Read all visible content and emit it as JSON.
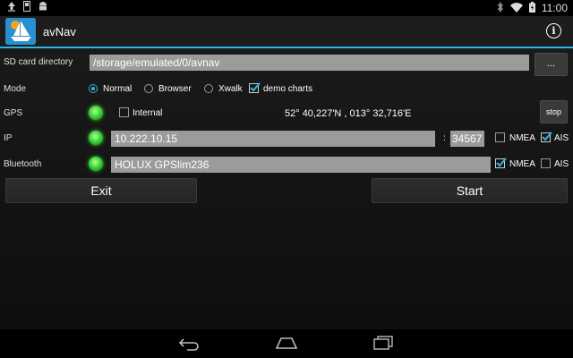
{
  "status_bar": {
    "time": "11:00"
  },
  "app": {
    "title": "avNav"
  },
  "sdcard": {
    "label": "SD card directory",
    "path": "/storage/emulated/0/avnav",
    "browse_label": "..."
  },
  "mode": {
    "label": "Mode",
    "options": [
      {
        "label": "Normal",
        "selected": true
      },
      {
        "label": "Browser",
        "selected": false
      },
      {
        "label": "Xwalk",
        "selected": false
      }
    ],
    "demo_charts": {
      "label": "demo charts",
      "checked": true
    }
  },
  "gps": {
    "label": "GPS",
    "internal_label": "Internal",
    "internal_checked": false,
    "position": "52° 40,227'N , 013° 32,716'E",
    "stop_label": "stop"
  },
  "ip": {
    "label": "IP",
    "address": "10.222.10.15",
    "separator": ":",
    "port": "34567",
    "nmea_label": "NMEA",
    "nmea_checked": false,
    "ais_label": "AIS",
    "ais_checked": true
  },
  "bluetooth": {
    "label": "Bluetooth",
    "device": "HOLUX GPSlim236",
    "nmea_label": "NMEA",
    "nmea_checked": true,
    "ais_label": "AIS",
    "ais_checked": false
  },
  "buttons": {
    "exit_label": "Exit",
    "start_label": "Start"
  },
  "colors": {
    "accent": "#33b5e5",
    "led_green": "#3cd63a",
    "field_bg": "#9b9b9b"
  }
}
